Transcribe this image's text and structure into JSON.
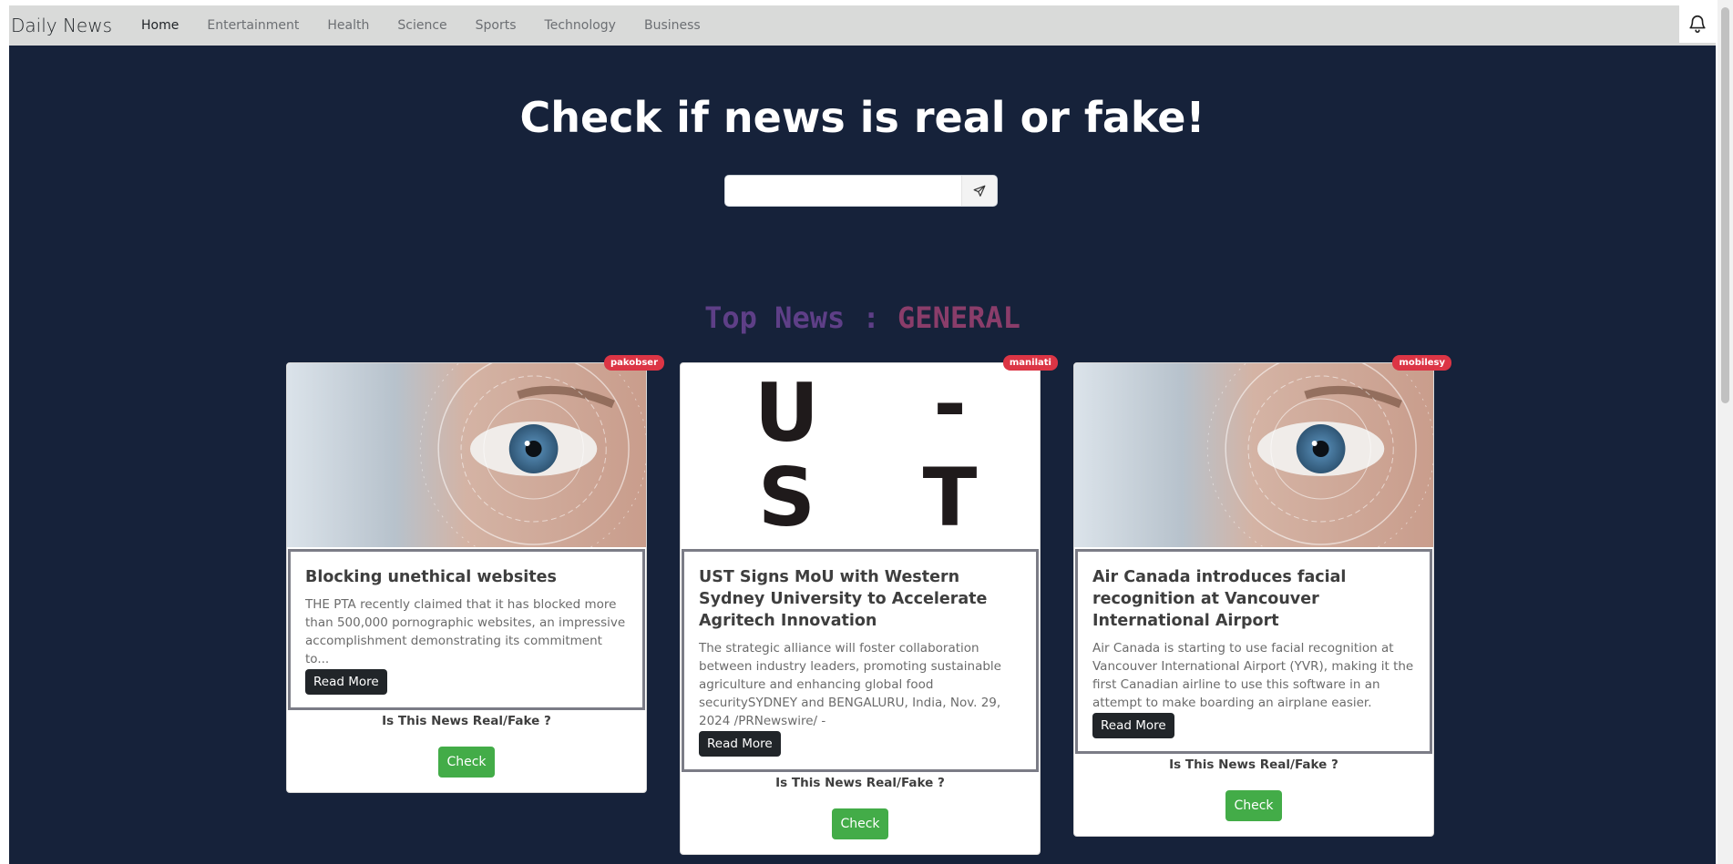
{
  "nav": {
    "brand": "Daily News",
    "links": [
      "Home",
      "Entertainment",
      "Health",
      "Science",
      "Sports",
      "Technology",
      "Business"
    ]
  },
  "hero": {
    "title": "Check if news is real or fake!",
    "search_placeholder": ""
  },
  "section": {
    "title_part1": "Top News : ",
    "title_part2": "GENERAL"
  },
  "cards": [
    {
      "source": "pakobser",
      "title": "Blocking unethical websites",
      "description": "THE PTA recently claimed that it has blocked more than 500,000 pornographic websites, an impressive accomplishment demonstrating its commitment to...",
      "read_more": "Read More",
      "question": "Is This News Real/Fake ?",
      "check": "Check"
    },
    {
      "source": "manilati",
      "title": "UST Signs MoU with Western Sydney University to Accelerate Agritech Innovation",
      "description": "The strategic alliance will foster collaboration between industry leaders, promoting sustainable agriculture and enhancing global food securitySYDNEY and BENGALURU, India, Nov. 29, 2024 /PRNewswire/ -",
      "read_more": "Read More",
      "question": "Is This News Real/Fake ?",
      "check": "Check",
      "image_text": [
        "U",
        "-",
        "S",
        "T"
      ]
    },
    {
      "source": "mobilesy",
      "title": "Air Canada introduces facial recognition at Vancouver International Airport",
      "description": "Air Canada is starting to use facial recognition at Vancouver International Airport (YVR), making it the first Canadian airline to use this software in an attempt to make boarding an airplane easier.",
      "read_more": "Read More",
      "question": "Is This News Real/Fake ?",
      "check": "Check"
    }
  ],
  "colors": {
    "navbar_bg": "#d9dad9",
    "main_bg": "#16223a",
    "badge": "#dc3545",
    "check_button": "#43ac48",
    "read_more_button": "#212529"
  },
  "icons": {
    "bell": "bell-icon",
    "send": "send-icon"
  }
}
